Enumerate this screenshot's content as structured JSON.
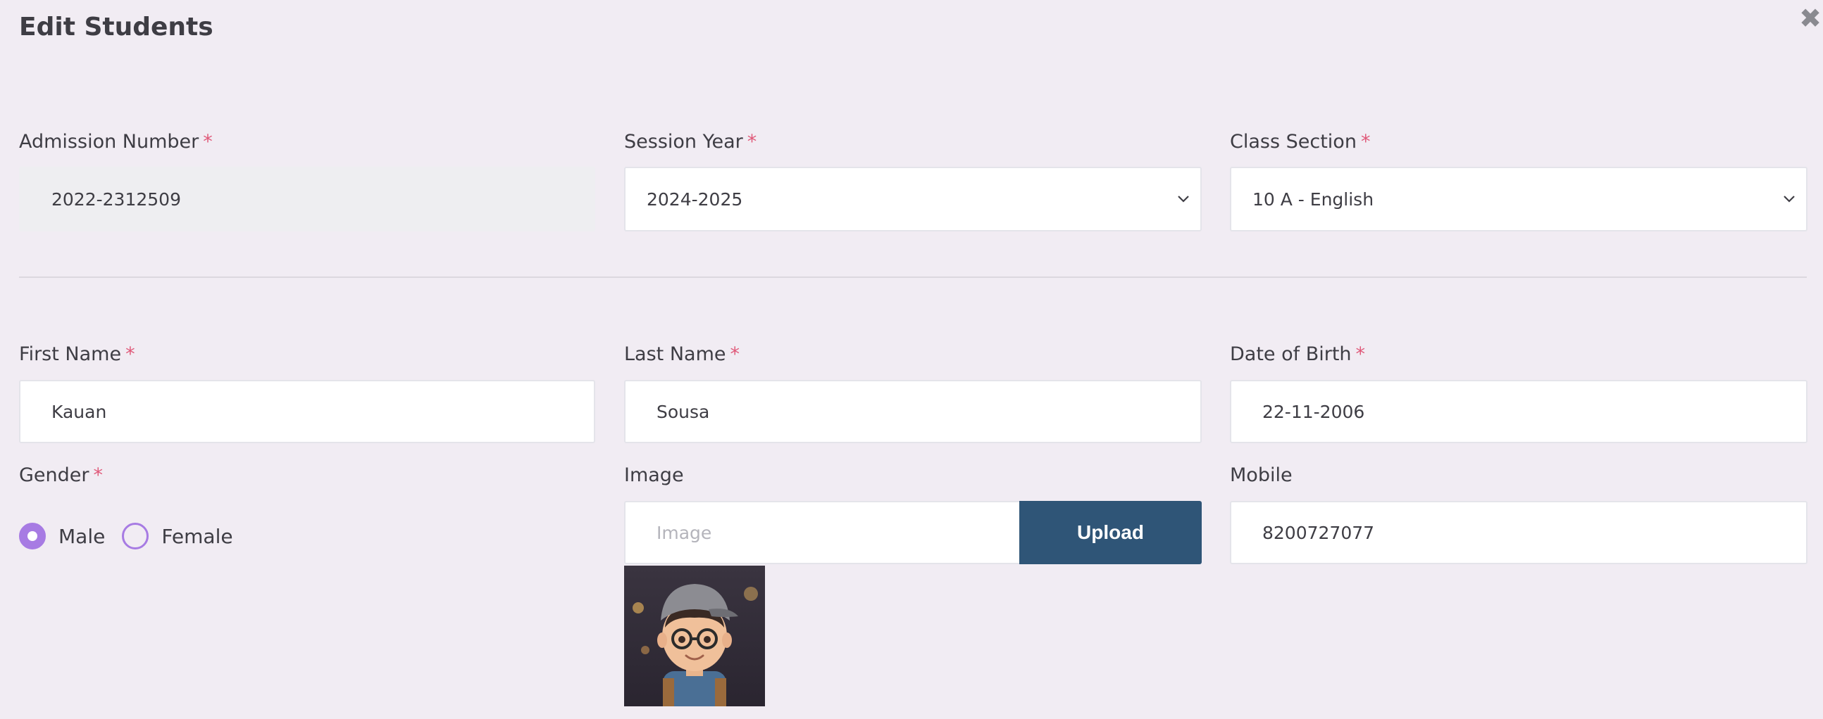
{
  "modal": {
    "title": "Edit Students",
    "close_icon": "close-icon",
    "required_marker": "*"
  },
  "admission": {
    "label": "Admission Number",
    "value": "2022-2312509"
  },
  "session_year": {
    "label": "Session Year",
    "value": "2024-2025"
  },
  "class_section": {
    "label": "Class Section",
    "value": "10 A - English"
  },
  "first_name": {
    "label": "First Name",
    "value": "Kauan"
  },
  "last_name": {
    "label": "Last Name",
    "value": "Sousa"
  },
  "dob": {
    "label": "Date of Birth",
    "value": "22-11-2006"
  },
  "gender": {
    "label": "Gender",
    "options": [
      "Male",
      "Female"
    ],
    "selected": "Male"
  },
  "image": {
    "label": "Image",
    "placeholder": "Image",
    "upload_label": "Upload"
  },
  "mobile": {
    "label": "Mobile",
    "value": "8200727077"
  },
  "colors": {
    "background": "#f1ecf3",
    "accent_radio": "#a77be3",
    "upload_button": "#2f5577",
    "required": "#e05a7a"
  }
}
